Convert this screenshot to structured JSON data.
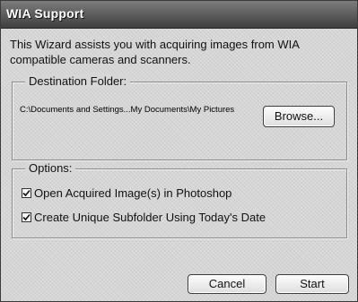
{
  "window": {
    "title": "WIA Support"
  },
  "intro": "This Wizard assists you with acquiring images from WIA compatible cameras and scanners.",
  "destination": {
    "legend": "Destination Folder:",
    "path": "C:\\Documents and Settings...My Documents\\My Pictures",
    "browse_label": "Browse..."
  },
  "options": {
    "legend": "Options:",
    "items": [
      {
        "label": "Open Acquired Image(s) in Photoshop",
        "checked": true
      },
      {
        "label": "Create Unique Subfolder Using Today's Date",
        "checked": true
      }
    ]
  },
  "buttons": {
    "cancel": "Cancel",
    "start": "Start"
  },
  "icons": {
    "checkmark": "checkmark-icon"
  }
}
